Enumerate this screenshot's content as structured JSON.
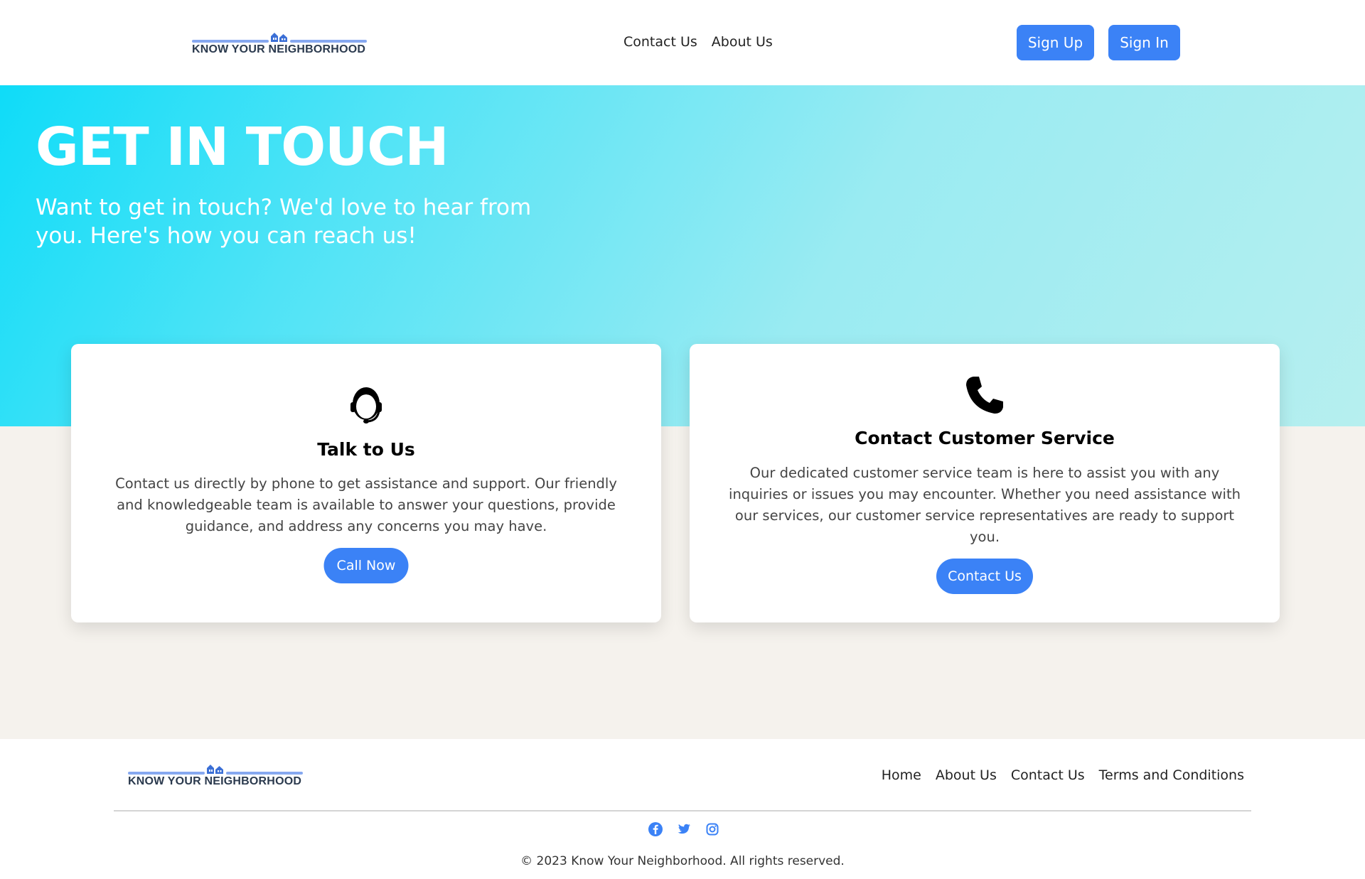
{
  "header": {
    "logo_text": "KNOW YOUR NEIGHBORHOOD",
    "nav": [
      {
        "label": "Contact Us"
      },
      {
        "label": "About Us"
      }
    ],
    "signup_label": "Sign Up",
    "signin_label": "Sign In"
  },
  "hero": {
    "title": "GET IN TOUCH",
    "subtitle": "Want to get in touch? We'd love to hear from you. Here's how you can reach us!"
  },
  "cards": [
    {
      "icon": "headset-support-icon",
      "title": "Talk to Us",
      "description": "Contact us directly by phone to get assistance and support. Our friendly and knowledgeable team is available to answer your questions, provide guidance, and address any concerns you may have.",
      "button": "Call Now"
    },
    {
      "icon": "phone-icon",
      "title": "Contact Customer Service",
      "description": "Our dedicated customer service team is here to assist you with any inquiries or issues you may encounter. Whether you need assistance with our services, our customer service representatives are ready to support you.",
      "button": "Contact Us"
    }
  ],
  "footer": {
    "logo_text": "KNOW YOUR NEIGHBORHOOD",
    "nav": [
      {
        "label": "Home"
      },
      {
        "label": "About Us"
      },
      {
        "label": "Contact Us"
      },
      {
        "label": "Terms and Conditions"
      }
    ],
    "social": [
      "facebook-icon",
      "twitter-icon",
      "instagram-icon"
    ],
    "copyright": "© 2023 Know Your Neighborhood. All rights reserved."
  },
  "colors": {
    "accent": "#3b82f6",
    "hero_start": "#0fdcf8",
    "hero_end": "#b6efef",
    "page_bg": "#f5f2ed"
  }
}
